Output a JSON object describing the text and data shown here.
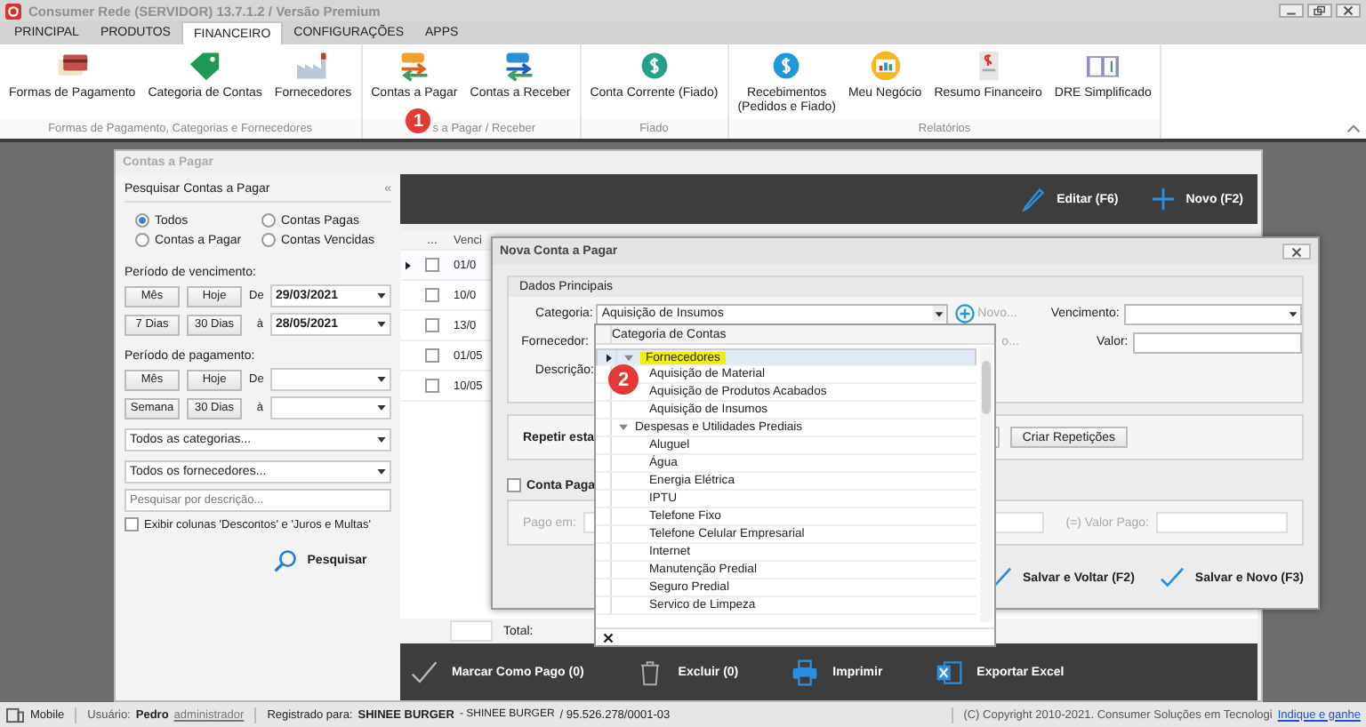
{
  "app": {
    "title": "Consumer Rede (SERVIDOR) 13.7.1.2 / Versão Premium"
  },
  "menu_tabs": [
    {
      "label": "PRINCIPAL",
      "selected": false
    },
    {
      "label": "PRODUTOS",
      "selected": false
    },
    {
      "label": "FINANCEIRO",
      "selected": true
    },
    {
      "label": "CONFIGURAÇÕES",
      "selected": false
    },
    {
      "label": "APPS",
      "selected": false
    }
  ],
  "ribbon_groups": [
    {
      "label": "Formas de Pagamento, Categorias e Fornecedores",
      "buttons": [
        {
          "label": "Formas de Pagamento",
          "kind": "cards"
        },
        {
          "label": "Categoria de Contas",
          "kind": "tag"
        },
        {
          "label": "Fornecedores",
          "kind": "factory"
        }
      ]
    },
    {
      "label": "s a Pagar / Receber",
      "badge": "1",
      "buttons": [
        {
          "label": "Contas a Pagar",
          "kind": "pay"
        },
        {
          "label": "Contas a Receber",
          "kind": "receive"
        }
      ]
    },
    {
      "label": "Fiado",
      "buttons": [
        {
          "label": "Conta Corrente (Fiado)",
          "kind": "current"
        }
      ]
    },
    {
      "label": "Relatórios",
      "buttons": [
        {
          "label": "Recebimentos\n(Pedidos e Fiado)",
          "kind": "coin"
        },
        {
          "label": "Meu Negócio",
          "kind": "board"
        },
        {
          "label": "Resumo Financeiro",
          "kind": "summary"
        },
        {
          "label": "DRE Simplificado",
          "kind": "book"
        }
      ]
    }
  ],
  "contas_window": {
    "title": "Contas a Pagar",
    "search_panel": {
      "title": "Pesquisar Contas a Pagar",
      "collapse": "«",
      "radios": [
        {
          "label": "Todos",
          "selected": true
        },
        {
          "label": "Contas Pagas",
          "selected": false
        },
        {
          "label": "Contas a Pagar",
          "selected": false
        },
        {
          "label": "Contas Vencidas",
          "selected": false
        }
      ],
      "periods": [
        {
          "label": "Período de vencimento:",
          "buttons": [
            "Mês",
            "Hoje",
            "7 Dias",
            "30 Dias"
          ],
          "from_label": "De",
          "from_value": "29/03/2021",
          "to_label": "à",
          "to_value": "28/05/2021"
        },
        {
          "label": "Período de pagamento:",
          "buttons": [
            "Mês",
            "Hoje",
            "Semana",
            "30 Dias"
          ],
          "from_label": "De",
          "to_label": "à"
        }
      ],
      "selects": [
        "Todos as categorias...",
        "Todos os fornecedores..."
      ],
      "search_placeholder": "Pesquisar por descrição...",
      "extra_columns": {
        "label": "Exibir colunas 'Descontos' e 'Juros e Multas'",
        "checked": false
      },
      "search_button": "Pesquisar"
    },
    "toolbar": [
      {
        "label": "Editar (F6)",
        "kind": "edit"
      },
      {
        "label": "Novo (F2)",
        "kind": "add"
      }
    ],
    "grid": {
      "columns": [
        "...",
        "Venci"
      ],
      "rows": [
        {
          "selected": true,
          "checked": false,
          "vencimento": "01/0"
        },
        {
          "selected": false,
          "checked": false,
          "vencimento": "10/0"
        },
        {
          "selected": false,
          "checked": false,
          "vencimento": "13/0"
        },
        {
          "selected": false,
          "checked": false,
          "vencimento": "01/05"
        },
        {
          "selected": false,
          "checked": false,
          "vencimento": "10/05"
        }
      ],
      "total_label": "Total:"
    },
    "actions": [
      {
        "label": "Marcar Como Pago (0)",
        "kind": "check"
      },
      {
        "label": "Excluir (0)",
        "kind": "trash"
      },
      {
        "label": "Imprimir",
        "kind": "print"
      },
      {
        "label": "Exportar Excel",
        "kind": "excel"
      }
    ]
  },
  "dialog": {
    "title": "Nova Conta a Pagar",
    "group_title": "Dados Principais",
    "categoria_label": "Categoria:",
    "categoria_value": "Aquisição de Insumos",
    "novo": "Novo...",
    "novo_partial": "o...",
    "vencimento_label": "Vencimento:",
    "valor_label": "Valor:",
    "fornecedor_label": "Fornecedor:",
    "descricao_label": "Descrição:",
    "repetir_label": "Repetir esta",
    "criar_button": "Criar Repetições",
    "conta_paga": {
      "label": "Conta Paga",
      "checked": false
    },
    "pago_em_label": "Pago em:",
    "valor_pago_label": "(=) Valor Pago:",
    "buttons": [
      {
        "label": "Salvar e Voltar (F2)"
      },
      {
        "label": "Salvar e Novo (F3)"
      }
    ]
  },
  "dropdown": {
    "header": "Categoria de Contas",
    "badge": "2",
    "items": [
      {
        "label": "Fornecedores",
        "selected": true,
        "expanded": true,
        "children": [
          {
            "label": "Aquisição de Material"
          },
          {
            "label": "Aquisição de Produtos Acabados"
          },
          {
            "label": "Aquisição de Insumos"
          }
        ]
      },
      {
        "label": "Despesas e Utilidades Prediais",
        "selected": false,
        "expanded": true,
        "children": [
          {
            "label": "Aluguel"
          },
          {
            "label": "Água"
          },
          {
            "label": "Energia Elétrica"
          },
          {
            "label": "IPTU"
          },
          {
            "label": "Telefone Fixo"
          },
          {
            "label": "Telefone Celular Empresarial"
          },
          {
            "label": "Internet"
          },
          {
            "label": "Manutenção Predial"
          },
          {
            "label": "Seguro Predial"
          },
          {
            "label": "Servico de Limpeza"
          }
        ]
      }
    ]
  },
  "status_bar": {
    "mobile": "Mobile",
    "user_label": "Usuário:",
    "user": "Pedro",
    "role": "administrador",
    "registered_label": "Registrado para:",
    "company": "SHINEE BURGER",
    "company_2": "- SHINEE BURGER",
    "cnpj": "/ 95.526.278/0001-03",
    "copyright": "(C) Copyright 2010-2021. Consumer Soluções em Tecnologi",
    "link": "Indique e ganhe"
  }
}
